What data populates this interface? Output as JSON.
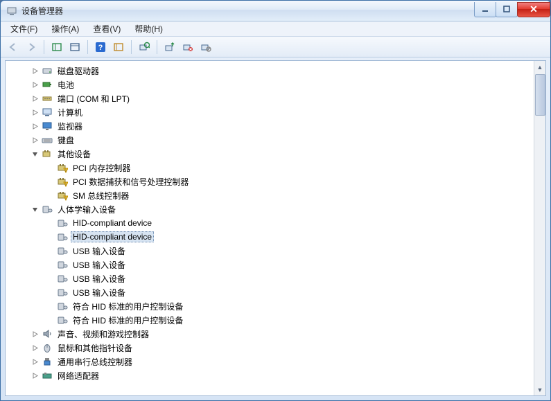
{
  "window": {
    "title": "设备管理器"
  },
  "menu": {
    "file": "文件(F)",
    "action": "操作(A)",
    "view": "查看(V)",
    "help": "帮助(H)"
  },
  "tree": {
    "items": [
      {
        "level": 1,
        "exp": "closed",
        "icon": "disk",
        "label": "磁盘驱动器"
      },
      {
        "level": 1,
        "exp": "closed",
        "icon": "battery",
        "label": "电池"
      },
      {
        "level": 1,
        "exp": "closed",
        "icon": "port",
        "label": "端口 (COM 和 LPT)"
      },
      {
        "level": 1,
        "exp": "closed",
        "icon": "computer",
        "label": "计算机"
      },
      {
        "level": 1,
        "exp": "closed",
        "icon": "monitor",
        "label": "监视器"
      },
      {
        "level": 1,
        "exp": "closed",
        "icon": "keyboard",
        "label": "键盘"
      },
      {
        "level": 1,
        "exp": "open",
        "icon": "other",
        "label": "其他设备"
      },
      {
        "level": 2,
        "exp": "none",
        "icon": "other-warn",
        "label": "PCI 内存控制器"
      },
      {
        "level": 2,
        "exp": "none",
        "icon": "other-warn",
        "label": "PCI 数据捕获和信号处理控制器"
      },
      {
        "level": 2,
        "exp": "none",
        "icon": "other-warn",
        "label": "SM 总线控制器"
      },
      {
        "level": 1,
        "exp": "open",
        "icon": "hid",
        "label": "人体学输入设备"
      },
      {
        "level": 2,
        "exp": "none",
        "icon": "hid",
        "label": "HID-compliant device"
      },
      {
        "level": 2,
        "exp": "none",
        "icon": "hid",
        "label": "HID-compliant device",
        "selected": true
      },
      {
        "level": 2,
        "exp": "none",
        "icon": "hid",
        "label": "USB 输入设备"
      },
      {
        "level": 2,
        "exp": "none",
        "icon": "hid",
        "label": "USB 输入设备"
      },
      {
        "level": 2,
        "exp": "none",
        "icon": "hid",
        "label": "USB 输入设备"
      },
      {
        "level": 2,
        "exp": "none",
        "icon": "hid",
        "label": "USB 输入设备"
      },
      {
        "level": 2,
        "exp": "none",
        "icon": "hid",
        "label": "符合 HID 标准的用户控制设备"
      },
      {
        "level": 2,
        "exp": "none",
        "icon": "hid",
        "label": "符合 HID 标准的用户控制设备"
      },
      {
        "level": 1,
        "exp": "closed",
        "icon": "sound",
        "label": "声音、视频和游戏控制器"
      },
      {
        "level": 1,
        "exp": "closed",
        "icon": "mouse",
        "label": "鼠标和其他指针设备"
      },
      {
        "level": 1,
        "exp": "closed",
        "icon": "usb",
        "label": "通用串行总线控制器"
      },
      {
        "level": 1,
        "exp": "closed",
        "icon": "network",
        "label": "网络适配器"
      }
    ]
  }
}
